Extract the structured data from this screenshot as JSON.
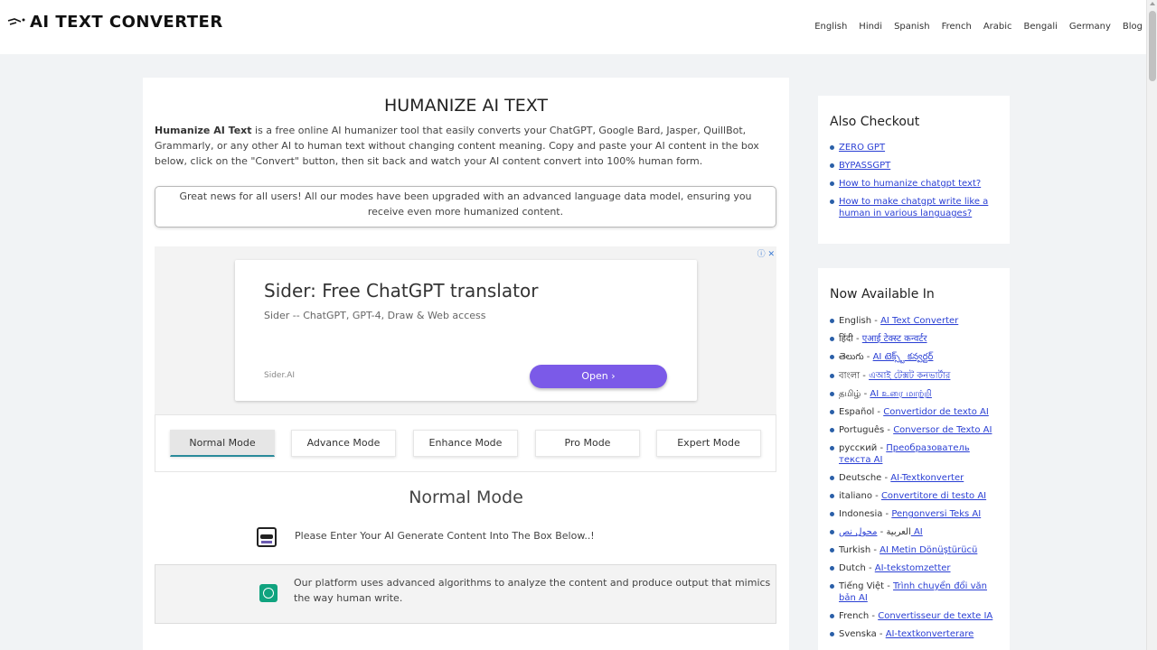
{
  "header": {
    "brand": "AI TEXT CONVERTER",
    "nav": [
      "English",
      "Hindi",
      "Spanish",
      "French",
      "Arabic",
      "Bengali",
      "Germany",
      "Blog"
    ]
  },
  "main": {
    "title": "HUMANIZE AI TEXT",
    "intro_bold": "Humanize AI Text",
    "intro_rest": " is a free online AI humanizer tool that easily converts your ChatGPT, Google Bard, Jasper, QuillBot, Grammarly, or any other AI to human text without changing content meaning. Copy and paste your AI content in the box below, click on the \"Convert\" button, then sit back and watch your AI content convert into 100% human form.",
    "notice": "Great news for all users! All our modes have been upgraded with an advanced language data model, ensuring you receive even more humanized content.",
    "ad": {
      "title": "Sider: Free ChatGPT translator",
      "subtitle": "Sider -- ChatGPT, GPT-4, Draw & Web access",
      "brand": "Sider.AI",
      "button": "Open"
    },
    "modes": [
      "Normal Mode",
      "Advance Mode",
      "Enhance Mode",
      "Pro Mode",
      "Expert Mode"
    ],
    "active_mode": "Normal Mode",
    "mode_heading": "Normal Mode",
    "prompt": "Please Enter Your AI Generate Content Into The Box Below..!",
    "info": "Our platform uses advanced algorithms to analyze the content and produce output that mimics the way human write."
  },
  "sidebar": {
    "also_title": "Also Checkout",
    "also_links": [
      "ZERO GPT",
      "BYPASSGPT",
      "How to humanize chatgpt text?",
      "How to make chatgpt write like a human in various languages?"
    ],
    "available_title": "Now Available In",
    "languages": [
      {
        "name": "English",
        "link": "AI Text Converter"
      },
      {
        "name": "हिंदी",
        "link": "एआई टेक्स्ट कन्वर्टर"
      },
      {
        "name": "తెలుగు",
        "link": "AI టెక్స్ట్ కన్వర్టర్"
      },
      {
        "name": "বাংলা",
        "link": "এআই টেক্সট কনভার্টার"
      },
      {
        "name": "தமிழ்",
        "link": "AI உரை மாற்றி"
      },
      {
        "name": "Español",
        "link": "Convertidor de texto AI"
      },
      {
        "name": "Português",
        "link": "Conversor de Texto AI"
      },
      {
        "name": "русский",
        "link": "Преобразователь текста AI"
      },
      {
        "name": "Deutsche",
        "link": "AI-Textkonverter"
      },
      {
        "name": "italiano",
        "link": "Convertitore di testo AI"
      },
      {
        "name": "Indonesia",
        "link": "Pengonversi Teks AI"
      },
      {
        "name": "العربية",
        "link": "محول نص AI"
      },
      {
        "name": "Turkish",
        "link": "AI Metin Dönüştürücü"
      },
      {
        "name": "Dutch",
        "link": "AI-tekstomzetter"
      },
      {
        "name": "Tiếng Việt",
        "link": "Trình chuyển đổi văn bản AI"
      },
      {
        "name": "French",
        "link": "Convertisseur de texte IA"
      },
      {
        "name": "Svenska",
        "link": "AI-textkonverterare"
      }
    ]
  },
  "colors": {
    "accent": "#7b5ae8",
    "link": "#2a3fd4",
    "bullet": "#2a5fa8"
  }
}
